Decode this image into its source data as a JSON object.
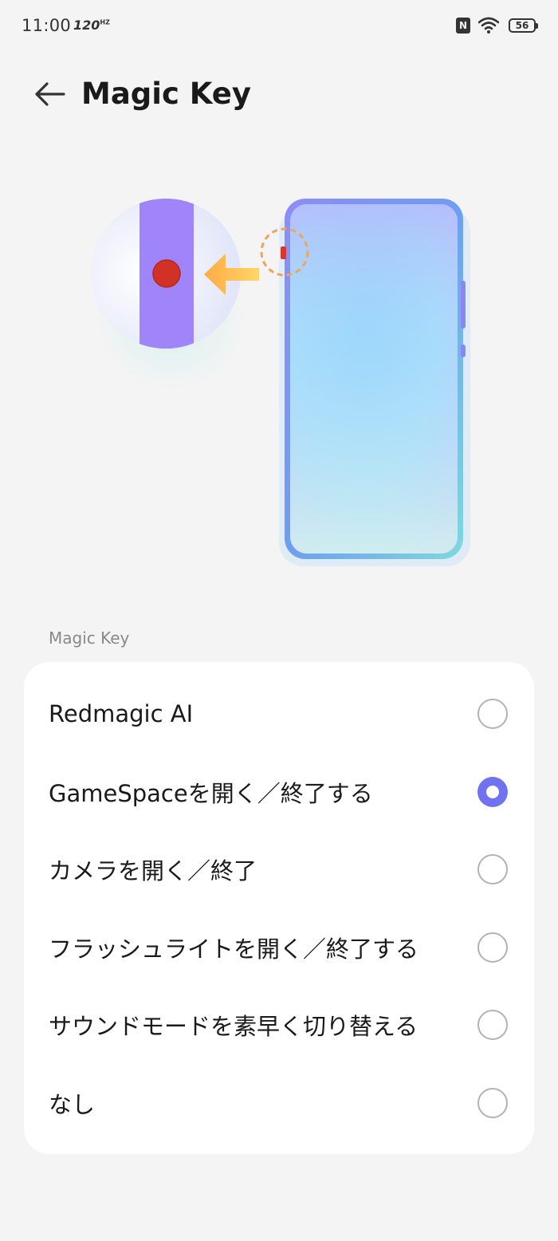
{
  "status_bar": {
    "time": "11:00",
    "refresh_rate": "120",
    "refresh_unit": "HZ",
    "nfc": "N",
    "battery": "56"
  },
  "header": {
    "title": "Magic Key",
    "back_icon": "arrow-left-icon"
  },
  "section": {
    "title": "Magic Key"
  },
  "options": [
    {
      "label": "Redmagic AI",
      "selected": false
    },
    {
      "label": "GameSpaceを開く／終了する",
      "selected": true
    },
    {
      "label": "カメラを開く／終了",
      "selected": false
    },
    {
      "label": "フラッシュライトを開く／終了する",
      "selected": false
    },
    {
      "label": "サウンドモードを素早く切り替える",
      "selected": false
    },
    {
      "label": "なし",
      "selected": false
    }
  ],
  "colors": {
    "accent": "#6f73f2",
    "background": "#f4f4f4",
    "card": "#ffffff"
  }
}
